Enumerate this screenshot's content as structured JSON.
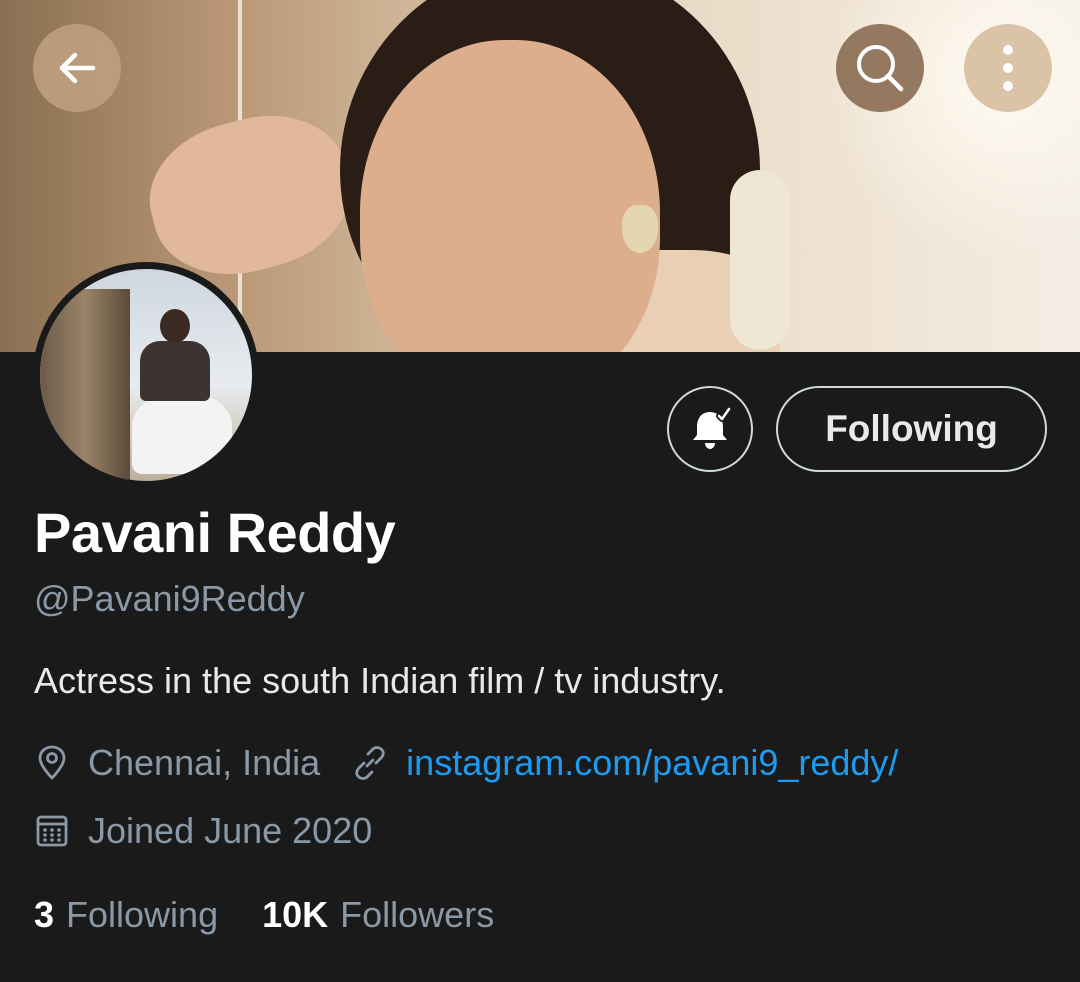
{
  "profile": {
    "name": "Pavani Reddy",
    "handle": "@Pavani9Reddy",
    "bio": "Actress in the south Indian film / tv industry.",
    "location": "Chennai, India",
    "website": "instagram.com/pavani9_reddy/",
    "joined": "Joined June 2020"
  },
  "actions": {
    "following_label": "Following"
  },
  "stats": {
    "following_count": "3",
    "following_label": "Following",
    "followers_count": "10K",
    "followers_label": "Followers"
  },
  "icons": {
    "back": "arrow-left-icon",
    "search": "search-icon",
    "more": "more-vertical-icon",
    "notifications": "bell-check-icon",
    "location": "location-pin-icon",
    "link": "link-icon",
    "calendar": "calendar-icon"
  },
  "colors": {
    "background": "#1a1a1b",
    "text_primary": "#e7e9ea",
    "text_secondary": "#8b98a5",
    "link": "#1d9bf0",
    "button_border": "#cfd9de"
  }
}
